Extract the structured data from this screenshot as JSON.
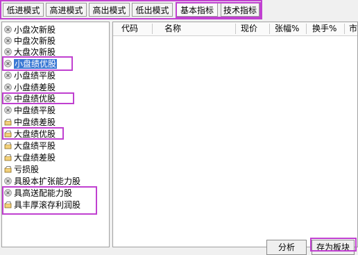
{
  "tabs": [
    {
      "label": "低进模式"
    },
    {
      "label": "高进模式"
    },
    {
      "label": "高出模式"
    },
    {
      "label": "低出模式"
    },
    {
      "label": "基本指标"
    },
    {
      "label": "技术指标"
    }
  ],
  "sidebar": {
    "items": [
      {
        "label": "小盘次新股",
        "icon": "x-circle-icon"
      },
      {
        "label": "中盘次新股",
        "icon": "x-circle-icon"
      },
      {
        "label": "大盘次新股",
        "icon": "x-circle-icon"
      },
      {
        "label": "小盘绩优股",
        "icon": "x-circle-icon",
        "selected": true
      },
      {
        "label": "小盘绩平股",
        "icon": "x-circle-icon"
      },
      {
        "label": "小盘绩差股",
        "icon": "x-circle-icon"
      },
      {
        "label": "中盘绩优股",
        "icon": "x-circle-icon"
      },
      {
        "label": "中盘绩平股",
        "icon": "x-circle-icon"
      },
      {
        "label": "中盘绩差股",
        "icon": "folder-icon"
      },
      {
        "label": "大盘绩优股",
        "icon": "folder-icon"
      },
      {
        "label": "大盘绩平股",
        "icon": "folder-icon"
      },
      {
        "label": "大盘绩差股",
        "icon": "folder-icon"
      },
      {
        "label": "亏损股",
        "icon": "folder-icon"
      },
      {
        "label": "具股本扩张能力股",
        "icon": "x-circle-icon"
      },
      {
        "label": "具高送配能力股",
        "icon": "x-circle-icon"
      },
      {
        "label": "具丰厚滚存利润股",
        "icon": "folder-icon"
      }
    ]
  },
  "table": {
    "columns": [
      "代码",
      "名称",
      "现价",
      "张幅%",
      "换手%",
      "市"
    ]
  },
  "buttons": {
    "analyze_label": "分析",
    "save_label": "存为板块"
  },
  "colors": {
    "highlight": "#c040d0",
    "selection": "#3a78d4"
  }
}
